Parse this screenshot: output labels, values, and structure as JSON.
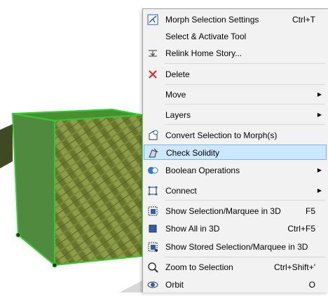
{
  "menu": {
    "items": [
      {
        "icon": "morph-settings-icon",
        "label": "Morph Selection Settings",
        "shortcut": "Ctrl+T"
      },
      {
        "icon": "",
        "label": "Select & Activate Tool",
        "shortcut": ""
      },
      {
        "icon": "relink-story-icon",
        "label": "Relink Home Story...",
        "shortcut": ""
      },
      {
        "icon": "delete-icon",
        "label": "Delete",
        "shortcut": ""
      },
      {
        "icon": "",
        "label": "Move",
        "shortcut": "",
        "submenu": true
      },
      {
        "icon": "",
        "label": "Layers",
        "shortcut": "",
        "submenu": true
      },
      {
        "icon": "convert-morph-icon",
        "label": "Convert Selection to Morph(s)",
        "shortcut": ""
      },
      {
        "icon": "check-solidity-icon",
        "label": "Check Solidity",
        "shortcut": ""
      },
      {
        "icon": "boolean-icon",
        "label": "Boolean Operations",
        "shortcut": "",
        "submenu": true
      },
      {
        "icon": "connect-icon",
        "label": "Connect",
        "shortcut": "",
        "submenu": true
      },
      {
        "icon": "show-selection-3d-icon",
        "label": "Show Selection/Marquee in 3D",
        "shortcut": "F5"
      },
      {
        "icon": "show-all-3d-icon",
        "label": "Show All in 3D",
        "shortcut": "Ctrl+F5"
      },
      {
        "icon": "show-stored-3d-icon",
        "label": "Show Stored Selection/Marquee in 3D",
        "shortcut": ""
      },
      {
        "icon": "zoom-selection-icon",
        "label": "Zoom to Selection",
        "shortcut": "Ctrl+Shift+'"
      },
      {
        "icon": "orbit-icon",
        "label": "Orbit",
        "shortcut": "O"
      }
    ]
  },
  "colors": {
    "menu_bg": "#f2f2f2",
    "highlight": "#cce8ff",
    "highlight_border": "#7eb4ea",
    "cube_outline": "#2fcf2f"
  }
}
